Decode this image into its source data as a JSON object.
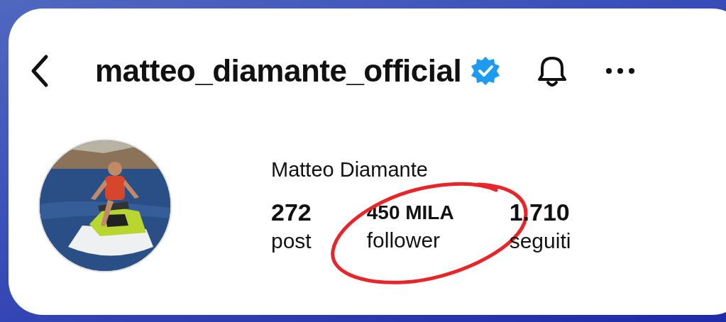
{
  "header": {
    "username": "matteo_diamante_official",
    "verified": true
  },
  "profile": {
    "name": "Matteo Diamante",
    "stats": [
      {
        "value": "272",
        "label": "post",
        "highlighted": false
      },
      {
        "value": "450 MILA",
        "label": "follower",
        "highlighted": true
      },
      {
        "value": "1.710",
        "label": "seguiti",
        "highlighted": false
      }
    ]
  }
}
